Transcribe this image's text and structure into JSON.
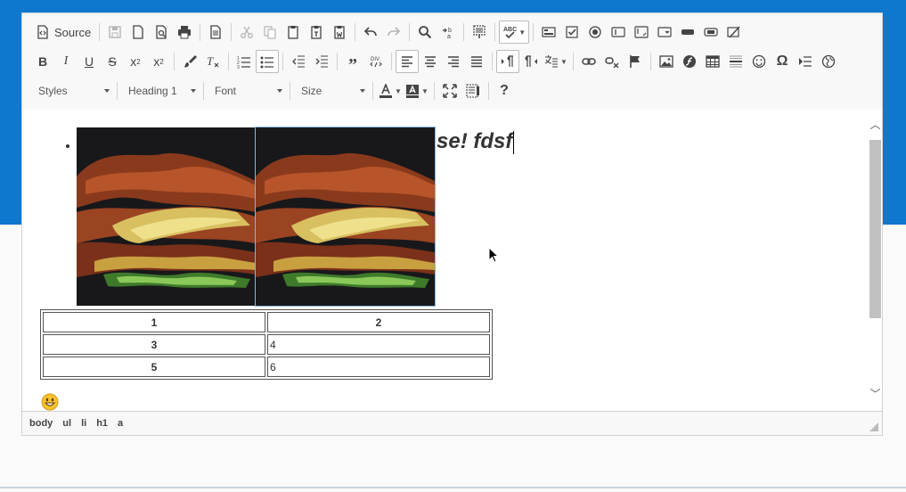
{
  "toolbar": {
    "source_label": "Source",
    "combos": {
      "styles": "Styles",
      "format": "Heading 1",
      "font": "Font",
      "size": "Size"
    },
    "div_label": "DIV",
    "omega": "Ω",
    "help": "?"
  },
  "content": {
    "heading_text": "se! fdsf",
    "table": [
      [
        "1",
        "2"
      ],
      [
        "3",
        "4"
      ],
      [
        "5",
        "6"
      ]
    ]
  },
  "statusbar": {
    "path": [
      "body",
      "ul",
      "li",
      "h1",
      "a"
    ]
  },
  "colors": {
    "background_band": "#0e78cf",
    "selection_outline": "#86b6db"
  }
}
